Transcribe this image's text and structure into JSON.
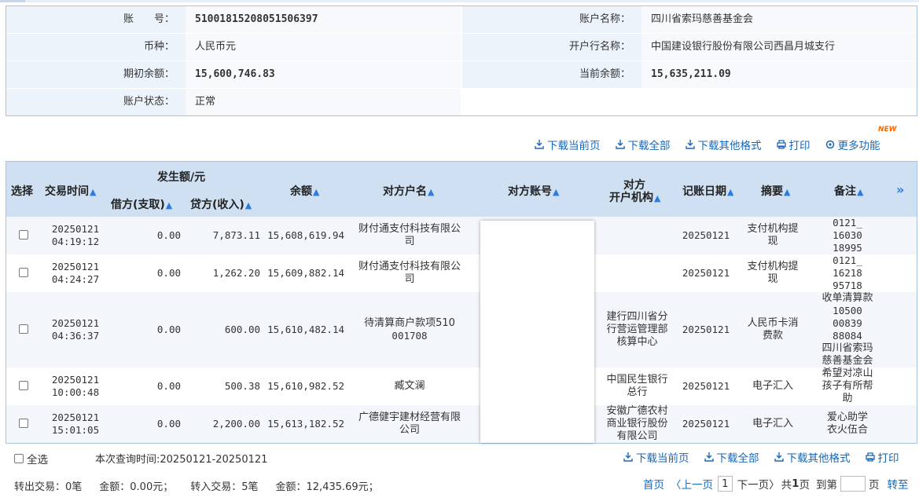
{
  "account": {
    "account_no_label": "账　　号：",
    "account_no": "510018152080515063 97",
    "account_name_label": "账户名称：",
    "account_name": "四川省索玛慈善基金会",
    "currency_label": "币种：",
    "currency": "人民币元",
    "bank_label": "开户行名称：",
    "bank": "中国建设银行股份有限公司西昌月城支行",
    "opening_balance_label": "期初余额：",
    "opening_balance": "15,600,746.83",
    "current_balance_label": "当前余额：",
    "current_balance": "15,635,211.09",
    "status_label": "账户状态：",
    "status": "正常"
  },
  "toolbar": {
    "download_page": "下载当前页",
    "download_all": "下载全部",
    "download_other": "下载其他格式",
    "print": "打印",
    "more": "更多功能",
    "new_badge": "NEW"
  },
  "table": {
    "headers": {
      "select": "选择",
      "time": "交易时间",
      "amount_group": "发生额/元",
      "debit": "借方(支取)",
      "credit": "贷方(收入)",
      "balance": "余额",
      "counterparty_name": "对方户名",
      "counterparty_account": "对方账号",
      "counterparty_bank_line1": "对方",
      "counterparty_bank_line2": "开户机构",
      "post_date": "记账日期",
      "summary": "摘要",
      "remark": "备注",
      "expand": "»"
    },
    "rows": [
      {
        "date": "20250121",
        "time": "04:19:12",
        "debit": "0.00",
        "credit": "7,873.11",
        "balance": "15,608,619.94",
        "name_l1": "财付通支付科技有限公",
        "name_l2": "司",
        "bank_l1": "",
        "bank_l2": "",
        "bank_l3": "",
        "post_date": "20250121",
        "summary_l1": "支付机构提",
        "summary_l2": "现",
        "remark_l1": "0121_",
        "remark_l2": "16030",
        "remark_l3": "18995",
        "remark_l4": "",
        "remark_l5": "",
        "remark_l6": ""
      },
      {
        "date": "20250121",
        "time": "04:24:27",
        "debit": "0.00",
        "credit": "1,262.20",
        "balance": "15,609,882.14",
        "name_l1": "财付通支付科技有限公",
        "name_l2": "司",
        "bank_l1": "",
        "bank_l2": "",
        "bank_l3": "",
        "post_date": "20250121",
        "summary_l1": "支付机构提",
        "summary_l2": "现",
        "remark_l1": "0121_",
        "remark_l2": "16218",
        "remark_l3": "95718",
        "remark_l4": "",
        "remark_l5": "",
        "remark_l6": ""
      },
      {
        "date": "20250121",
        "time": "04:36:37",
        "debit": "0.00",
        "credit": "600.00",
        "balance": "15,610,482.14",
        "name_l1": "待清算商户款项510",
        "name_l2": "001708",
        "bank_l1": "建行四川省分",
        "bank_l2": "行营运管理部",
        "bank_l3": "核算中心",
        "post_date": "20250121",
        "summary_l1": "人民币卡消",
        "summary_l2": "费款",
        "remark_l1": "收单清算款",
        "remark_l2": "10500",
        "remark_l3": "00839",
        "remark_l4": "88084",
        "remark_l5": "四川省索玛",
        "remark_l6": "慈善基金会"
      },
      {
        "date": "20250121",
        "time": "10:00:48",
        "debit": "0.00",
        "credit": "500.38",
        "balance": "15,610,982.52",
        "name_l1": "臧文澜",
        "name_l2": "",
        "bank_l1": "中国民生银行",
        "bank_l2": "总行",
        "bank_l3": "",
        "post_date": "20250121",
        "summary_l1": "电子汇入",
        "summary_l2": "",
        "remark_l1": "希望对凉山",
        "remark_l2": "孩子有所帮",
        "remark_l3": "助",
        "remark_l4": "",
        "remark_l5": "",
        "remark_l6": ""
      },
      {
        "date": "20250121",
        "time": "15:01:05",
        "debit": "0.00",
        "credit": "2,200.00",
        "balance": "15,613,182.52",
        "name_l1": "广德健宇建材经营有限",
        "name_l2": "公司",
        "bank_l1": "安徽广德农村",
        "bank_l2": "商业银行股份",
        "bank_l3": "有限公司",
        "post_date": "20250121",
        "summary_l1": "电子汇入",
        "summary_l2": "",
        "remark_l1": "爱心助学",
        "remark_l2": "衣火伍合",
        "remark_l3": "",
        "remark_l4": "",
        "remark_l5": "",
        "remark_l6": ""
      }
    ]
  },
  "footer": {
    "select_all": "全选",
    "query_time": "本次查询时间:20250121-20250121",
    "out_count": "转出交易：0笔",
    "out_amount": "金额：0.00元；",
    "in_count": "转入交易：5笔",
    "in_amount": "金额：12,435.69元；"
  },
  "pager": {
    "first": "首页",
    "prev": "〈上一页",
    "current": "1",
    "next": "下一页〉",
    "total_prefix": "共",
    "total": "1",
    "total_suffix": "页",
    "goto_prefix": "到第",
    "goto_suffix": "页",
    "go": "转至"
  },
  "colors": {
    "header_bg": "#cfe0f3",
    "link": "#1a67b5",
    "sort_arrow": "#2c7be0",
    "new_badge": "#ff6600"
  }
}
